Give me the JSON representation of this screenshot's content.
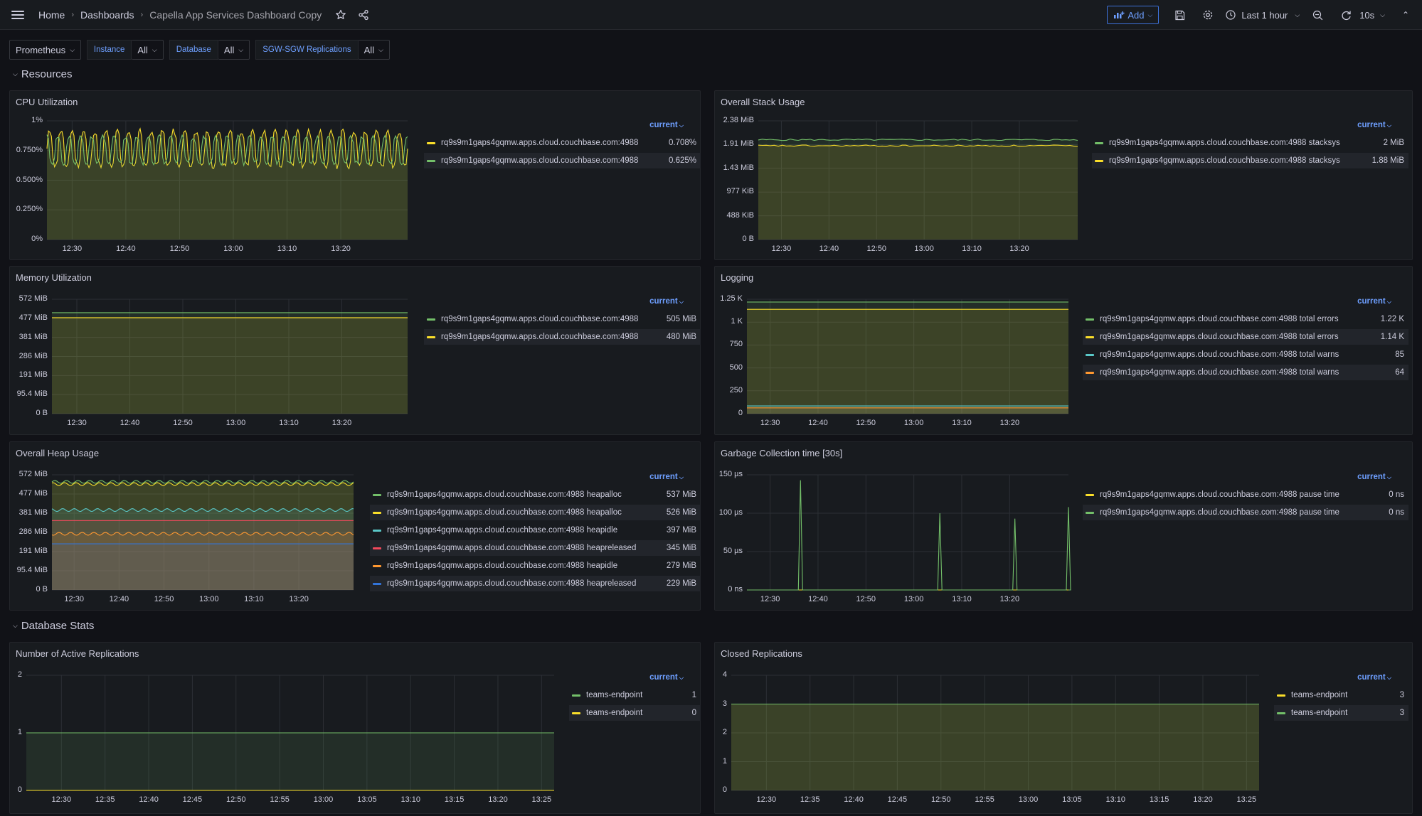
{
  "nav": {
    "breadcrumbs": [
      "Home",
      "Dashboards",
      "Capella App Services Dashboard Copy"
    ],
    "add_label": "Add",
    "time_range": "Last 1 hour",
    "refresh": "10s"
  },
  "variables": {
    "datasource": "Prometheus",
    "instance_label": "Instance",
    "instance_value": "All",
    "database_label": "Database",
    "database_value": "All",
    "replications_label": "SGW-SGW Replications",
    "replications_value": "All"
  },
  "rows": {
    "resources": "Resources",
    "database_stats": "Database Stats"
  },
  "colors": {
    "green": "#73bf69",
    "yellow": "#fade2a",
    "cyan": "#5ac8c8",
    "red": "#f2495c",
    "orange": "#ff9830",
    "blue": "#3274d9",
    "accent": "#6e9fff"
  },
  "legend_header": "current",
  "panels": {
    "cpu": {
      "title": "CPU Utilization",
      "yticks": [
        "1%",
        "0.750%",
        "0.500%",
        "0.250%",
        "0%"
      ],
      "xticks": [
        "12:30",
        "12:40",
        "12:50",
        "13:00",
        "13:10",
        "13:20"
      ],
      "legend": [
        {
          "name": "rq9s9m1gaps4gqmw.apps.cloud.couchbase.com:4988",
          "value": "0.708%",
          "color": "#fade2a"
        },
        {
          "name": "rq9s9m1gaps4gqmw.apps.cloud.couchbase.com:4988",
          "value": "0.625%",
          "color": "#73bf69"
        }
      ]
    },
    "stack": {
      "title": "Overall Stack Usage",
      "yticks": [
        "2.38 MiB",
        "1.91 MiB",
        "1.43 MiB",
        "977 KiB",
        "488 KiB",
        "0 B"
      ],
      "xticks": [
        "12:30",
        "12:40",
        "12:50",
        "13:00",
        "13:10",
        "13:20"
      ],
      "legend": [
        {
          "name": "rq9s9m1gaps4gqmw.apps.cloud.couchbase.com:4988 stacksys",
          "value": "2 MiB",
          "color": "#73bf69"
        },
        {
          "name": "rq9s9m1gaps4gqmw.apps.cloud.couchbase.com:4988 stacksys",
          "value": "1.88 MiB",
          "color": "#fade2a"
        }
      ]
    },
    "memory": {
      "title": "Memory Utilization",
      "yticks": [
        "572 MiB",
        "477 MiB",
        "381 MiB",
        "286 MiB",
        "191 MiB",
        "95.4 MiB",
        "0 B"
      ],
      "xticks": [
        "12:30",
        "12:40",
        "12:50",
        "13:00",
        "13:10",
        "13:20"
      ],
      "legend": [
        {
          "name": "rq9s9m1gaps4gqmw.apps.cloud.couchbase.com:4988",
          "value": "505 MiB",
          "color": "#73bf69"
        },
        {
          "name": "rq9s9m1gaps4gqmw.apps.cloud.couchbase.com:4988",
          "value": "480 MiB",
          "color": "#fade2a"
        }
      ]
    },
    "logging": {
      "title": "Logging",
      "yticks": [
        "1.25 K",
        "1 K",
        "750",
        "500",
        "250",
        "0"
      ],
      "xticks": [
        "12:30",
        "12:40",
        "12:50",
        "13:00",
        "13:10",
        "13:20"
      ],
      "legend": [
        {
          "name": "rq9s9m1gaps4gqmw.apps.cloud.couchbase.com:4988 total errors",
          "value": "1.22 K",
          "color": "#73bf69"
        },
        {
          "name": "rq9s9m1gaps4gqmw.apps.cloud.couchbase.com:4988 total errors",
          "value": "1.14 K",
          "color": "#fade2a"
        },
        {
          "name": "rq9s9m1gaps4gqmw.apps.cloud.couchbase.com:4988 total warns",
          "value": "85",
          "color": "#5ac8c8"
        },
        {
          "name": "rq9s9m1gaps4gqmw.apps.cloud.couchbase.com:4988 total warns",
          "value": "64",
          "color": "#ff9830"
        }
      ]
    },
    "heap": {
      "title": "Overall Heap Usage",
      "yticks": [
        "572 MiB",
        "477 MiB",
        "381 MiB",
        "286 MiB",
        "191 MiB",
        "95.4 MiB",
        "0 B"
      ],
      "xticks": [
        "12:30",
        "12:40",
        "12:50",
        "13:00",
        "13:10",
        "13:20"
      ],
      "legend": [
        {
          "name": "rq9s9m1gaps4gqmw.apps.cloud.couchbase.com:4988 heapalloc",
          "value": "537 MiB",
          "color": "#73bf69"
        },
        {
          "name": "rq9s9m1gaps4gqmw.apps.cloud.couchbase.com:4988 heapalloc",
          "value": "526 MiB",
          "color": "#fade2a"
        },
        {
          "name": "rq9s9m1gaps4gqmw.apps.cloud.couchbase.com:4988 heapidle",
          "value": "397 MiB",
          "color": "#5ac8c8"
        },
        {
          "name": "rq9s9m1gaps4gqmw.apps.cloud.couchbase.com:4988 heapreleased",
          "value": "345 MiB",
          "color": "#f2495c"
        },
        {
          "name": "rq9s9m1gaps4gqmw.apps.cloud.couchbase.com:4988 heapidle",
          "value": "279 MiB",
          "color": "#ff9830"
        },
        {
          "name": "rq9s9m1gaps4gqmw.apps.cloud.couchbase.com:4988 heapreleased",
          "value": "229 MiB",
          "color": "#3274d9"
        }
      ]
    },
    "gc": {
      "title": "Garbage Collection time [30s]",
      "yticks": [
        "150 µs",
        "100 µs",
        "50 µs",
        "0 ns"
      ],
      "xticks": [
        "12:30",
        "12:40",
        "12:50",
        "13:00",
        "13:10",
        "13:20"
      ],
      "legend": [
        {
          "name": "rq9s9m1gaps4gqmw.apps.cloud.couchbase.com:4988 pause time",
          "value": "0 ns",
          "color": "#fade2a"
        },
        {
          "name": "rq9s9m1gaps4gqmw.apps.cloud.couchbase.com:4988 pause time",
          "value": "0 ns",
          "color": "#73bf69"
        }
      ]
    },
    "active": {
      "title": "Number of Active Replications",
      "yticks": [
        "2",
        "1",
        "0"
      ],
      "xticks": [
        "12:30",
        "12:35",
        "12:40",
        "12:45",
        "12:50",
        "12:55",
        "13:00",
        "13:05",
        "13:10",
        "13:15",
        "13:20",
        "13:25"
      ],
      "legend": [
        {
          "name": "teams-endpoint",
          "value": "1",
          "color": "#73bf69"
        },
        {
          "name": "teams-endpoint",
          "value": "0",
          "color": "#fade2a"
        }
      ]
    },
    "closed": {
      "title": "Closed Replications",
      "yticks": [
        "4",
        "3",
        "2",
        "1",
        "0"
      ],
      "xticks": [
        "12:30",
        "12:35",
        "12:40",
        "12:45",
        "12:50",
        "12:55",
        "13:00",
        "13:05",
        "13:10",
        "13:15",
        "13:20",
        "13:25"
      ],
      "legend": [
        {
          "name": "teams-endpoint",
          "value": "3",
          "color": "#fade2a"
        },
        {
          "name": "teams-endpoint",
          "value": "3",
          "color": "#73bf69"
        }
      ]
    }
  },
  "chart_data": [
    {
      "type": "line",
      "title": "CPU Utilization",
      "ylim": [
        0,
        1
      ],
      "yunit": "%",
      "x_range": [
        "12:25",
        "13:25"
      ],
      "series": [
        {
          "name": "rq9s9m1gaps4gqmw.apps.cloud.couchbase.com:4988",
          "color": "#fade2a",
          "range": [
            0.6,
            0.93
          ],
          "current": 0.708
        },
        {
          "name": "rq9s9m1gaps4gqmw.apps.cloud.couchbase.com:4988",
          "color": "#73bf69",
          "range": [
            0.63,
            0.88
          ],
          "current": 0.625
        }
      ]
    },
    {
      "type": "line",
      "title": "Overall Stack Usage",
      "ylim": [
        0,
        2.38
      ],
      "yunit": "MiB",
      "x_range": [
        "12:25",
        "13:25"
      ],
      "series": [
        {
          "name": "rq9s9m1gaps4gqmw.apps.cloud.couchbase.com:4988 stacksys",
          "color": "#73bf69",
          "current": 2.0
        },
        {
          "name": "rq9s9m1gaps4gqmw.apps.cloud.couchbase.com:4988 stacksys",
          "color": "#fade2a",
          "current": 1.88
        }
      ]
    },
    {
      "type": "line",
      "title": "Memory Utilization",
      "ylim": [
        0,
        572
      ],
      "yunit": "MiB",
      "x_range": [
        "12:25",
        "13:25"
      ],
      "series": [
        {
          "name": "rq9s9m1gaps4gqmw.apps.cloud.couchbase.com:4988",
          "color": "#73bf69",
          "current": 505
        },
        {
          "name": "rq9s9m1gaps4gqmw.apps.cloud.couchbase.com:4988",
          "color": "#fade2a",
          "current": 480
        }
      ]
    },
    {
      "type": "line",
      "title": "Logging",
      "ylim": [
        0,
        1250
      ],
      "x_range": [
        "12:25",
        "13:25"
      ],
      "series": [
        {
          "name": "rq9s9m1gaps4gqmw.apps.cloud.couchbase.com:4988 total errors",
          "color": "#73bf69",
          "current": 1220
        },
        {
          "name": "rq9s9m1gaps4gqmw.apps.cloud.couchbase.com:4988 total errors",
          "color": "#fade2a",
          "current": 1140
        },
        {
          "name": "rq9s9m1gaps4gqmw.apps.cloud.couchbase.com:4988 total warns",
          "color": "#5ac8c8",
          "current": 85
        },
        {
          "name": "rq9s9m1gaps4gqmw.apps.cloud.couchbase.com:4988 total warns",
          "color": "#ff9830",
          "current": 64
        }
      ]
    },
    {
      "type": "line",
      "title": "Overall Heap Usage",
      "ylim": [
        0,
        572
      ],
      "yunit": "MiB",
      "x_range": [
        "12:25",
        "13:25"
      ],
      "series": [
        {
          "name": "rq9s9m1gaps4gqmw.apps.cloud.couchbase.com:4988 heapalloc",
          "color": "#73bf69",
          "current": 537
        },
        {
          "name": "rq9s9m1gaps4gqmw.apps.cloud.couchbase.com:4988 heapalloc",
          "color": "#fade2a",
          "current": 526
        },
        {
          "name": "rq9s9m1gaps4gqmw.apps.cloud.couchbase.com:4988 heapidle",
          "color": "#5ac8c8",
          "current": 397
        },
        {
          "name": "rq9s9m1gaps4gqmw.apps.cloud.couchbase.com:4988 heapreleased",
          "color": "#f2495c",
          "current": 345
        },
        {
          "name": "rq9s9m1gaps4gqmw.apps.cloud.couchbase.com:4988 heapidle",
          "color": "#ff9830",
          "current": 279
        },
        {
          "name": "rq9s9m1gaps4gqmw.apps.cloud.couchbase.com:4988 heapreleased",
          "color": "#3274d9",
          "current": 229
        }
      ]
    },
    {
      "type": "line",
      "title": "Garbage Collection time [30s]",
      "ylim": [
        0,
        150
      ],
      "yunit": "µs",
      "x_range": [
        "12:25",
        "13:25"
      ],
      "spikes": [
        {
          "x": "12:35",
          "y": 143
        },
        {
          "x": "13:01",
          "y": 100
        },
        {
          "x": "13:15",
          "y": 93
        },
        {
          "x": "13:25",
          "y": 108
        }
      ],
      "series": [
        {
          "name": "rq9s9m1gaps4gqmw.apps.cloud.couchbase.com:4988 pause time",
          "color": "#fade2a",
          "current": 0
        },
        {
          "name": "rq9s9m1gaps4gqmw.apps.cloud.couchbase.com:4988 pause time",
          "color": "#73bf69",
          "current": 0
        }
      ]
    },
    {
      "type": "line",
      "title": "Number of Active Replications",
      "ylim": [
        0,
        2
      ],
      "x_range": [
        "12:27",
        "13:28"
      ],
      "series": [
        {
          "name": "teams-endpoint",
          "color": "#73bf69",
          "current": 1
        },
        {
          "name": "teams-endpoint",
          "color": "#fade2a",
          "current": 0
        }
      ]
    },
    {
      "type": "line",
      "title": "Closed Replications",
      "ylim": [
        0,
        4
      ],
      "x_range": [
        "12:27",
        "13:28"
      ],
      "series": [
        {
          "name": "teams-endpoint",
          "color": "#fade2a",
          "current": 3
        },
        {
          "name": "teams-endpoint",
          "color": "#73bf69",
          "current": 3
        }
      ]
    }
  ]
}
